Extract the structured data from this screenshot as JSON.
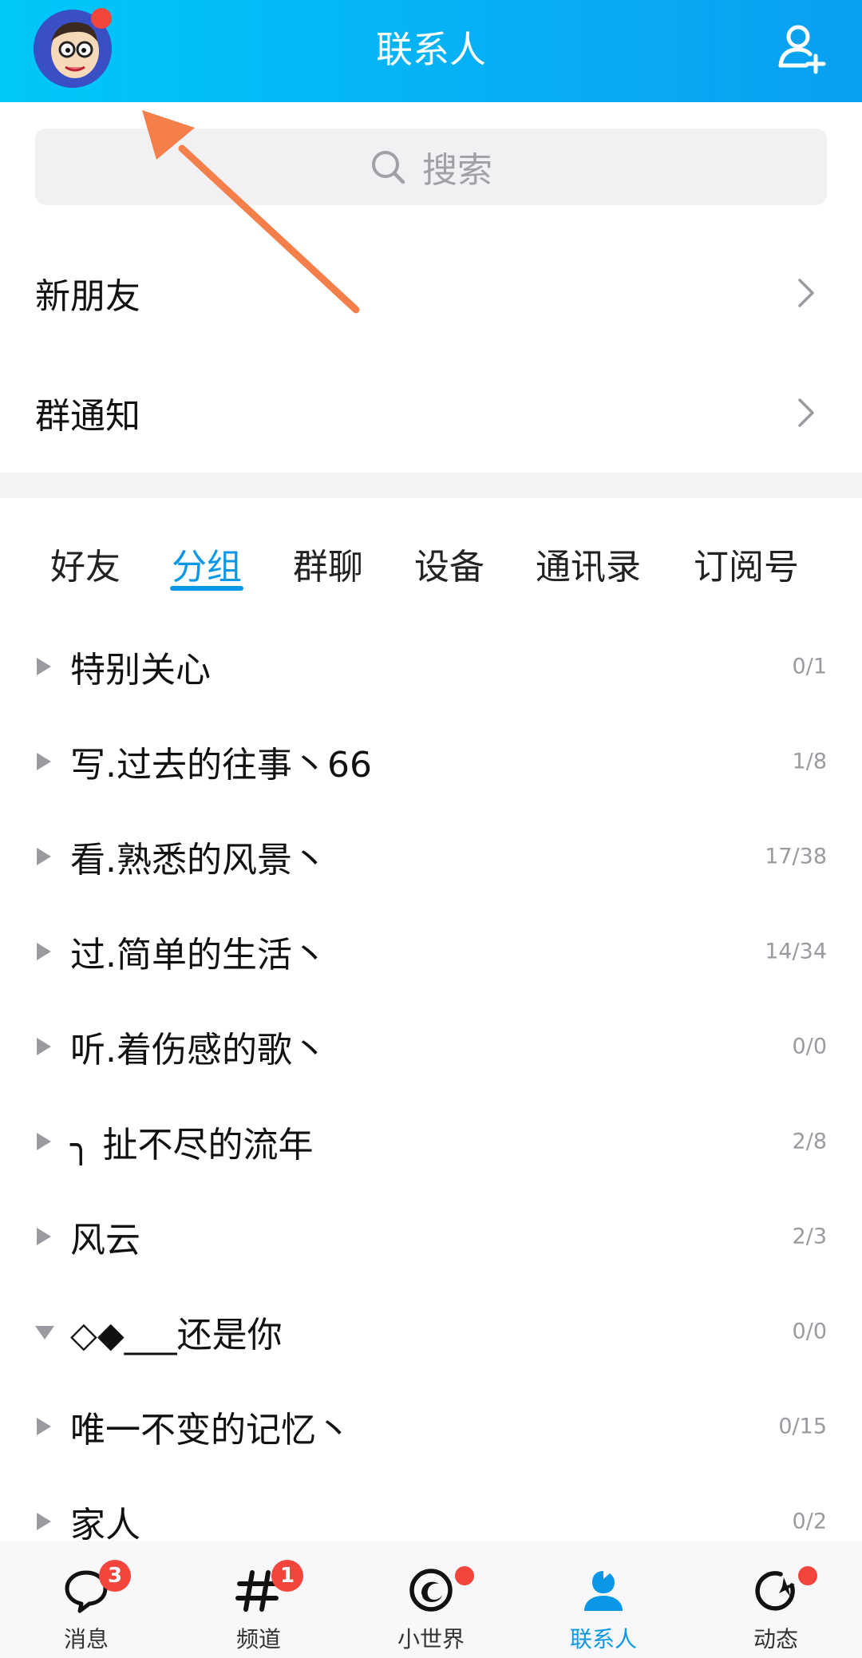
{
  "header": {
    "title": "联系人",
    "avatar_icon": "cartoon-avatar-icon",
    "add_contact_icon": "add-contact-icon"
  },
  "search": {
    "placeholder": "搜索",
    "icon": "search-icon"
  },
  "entries": [
    {
      "label": "新朋友",
      "icon": "chevron-right-icon"
    },
    {
      "label": "群通知",
      "icon": "chevron-right-icon"
    }
  ],
  "tabs": [
    {
      "label": "好友",
      "active": false
    },
    {
      "label": "分组",
      "active": true
    },
    {
      "label": "群聊",
      "active": false
    },
    {
      "label": "设备",
      "active": false
    },
    {
      "label": "通讯录",
      "active": false
    },
    {
      "label": "订阅号",
      "active": false
    }
  ],
  "groups": [
    {
      "name": "特别关心",
      "count": "0/1",
      "expanded": false
    },
    {
      "name": "写.过去的往事丶66",
      "count": "1/8",
      "expanded": false
    },
    {
      "name": "看.熟悉的风景丶",
      "count": "17/38",
      "expanded": false
    },
    {
      "name": "过.简单的生活丶",
      "count": "14/34",
      "expanded": false
    },
    {
      "name": "听.着伤感的歌丶",
      "count": "0/0",
      "expanded": false
    },
    {
      "name": "╮ 扯不尽的流年",
      "count": "2/8",
      "expanded": false
    },
    {
      "name": "风云",
      "count": "2/3",
      "expanded": false
    },
    {
      "name": "◇◆___还是你",
      "count": "0/0",
      "expanded": true
    },
    {
      "name": "唯一不变的记忆丶",
      "count": "0/15",
      "expanded": false
    },
    {
      "name": "家人",
      "count": "0/2",
      "expanded": false
    }
  ],
  "bottom_nav": [
    {
      "label": "消息",
      "icon": "message-icon",
      "badge": "3",
      "active": false
    },
    {
      "label": "频道",
      "icon": "channel-hash-icon",
      "badge": "1",
      "active": false
    },
    {
      "label": "小世界",
      "icon": "small-world-icon",
      "badge": "",
      "active": false
    },
    {
      "label": "联系人",
      "icon": "contacts-icon",
      "badge": "",
      "active": true
    },
    {
      "label": "动态",
      "icon": "activity-icon",
      "badge": "",
      "active": false
    }
  ],
  "colors": {
    "header_gradient_start": "#00c8f8",
    "header_gradient_end": "#0aa0f0",
    "accent": "#0a98e6",
    "badge_red": "#f2453c",
    "annotation_arrow": "#f57f4a"
  }
}
